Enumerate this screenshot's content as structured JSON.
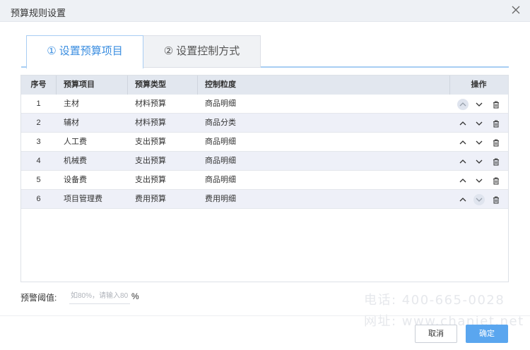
{
  "dialog": {
    "title": "预算规则设置",
    "close_icon": "close-icon"
  },
  "tabs": [
    {
      "label": "① 设置预算项目",
      "active": true
    },
    {
      "label": "② 设置控制方式",
      "active": false
    }
  ],
  "table": {
    "headers": {
      "no": "序号",
      "item": "预算项目",
      "type": "预算类型",
      "control": "控制粒度",
      "ops": "操作"
    },
    "rows": [
      {
        "no": "1",
        "item": "主材",
        "type": "材料预算",
        "control": "商品明细"
      },
      {
        "no": "2",
        "item": "辅材",
        "type": "材料预算",
        "control": "商品分类"
      },
      {
        "no": "3",
        "item": "人工费",
        "type": "支出预算",
        "control": "商品明细"
      },
      {
        "no": "4",
        "item": "机械费",
        "type": "支出预算",
        "control": "商品明细"
      },
      {
        "no": "5",
        "item": "设备费",
        "type": "支出预算",
        "control": "商品明细"
      },
      {
        "no": "6",
        "item": "项目管理费",
        "type": "费用预算",
        "control": "费用明细"
      }
    ],
    "op_icons": [
      "chevron-up-icon",
      "chevron-down-icon",
      "trash-icon"
    ]
  },
  "threshold": {
    "label": "预警阈值:",
    "placeholder": "如80%，请输入80",
    "value": "",
    "unit": "%"
  },
  "watermark": {
    "line1": "电话: 400-665-0028",
    "line2": "网址: www.chanjet.net"
  },
  "footer": {
    "cancel_label": "取消",
    "ok_label": "确定"
  },
  "colors": {
    "accent": "#3b8ee0",
    "primary_button": "#5aa6ef",
    "header_bg": "#e2e7ef",
    "even_row_bg": "#eef0f8"
  }
}
